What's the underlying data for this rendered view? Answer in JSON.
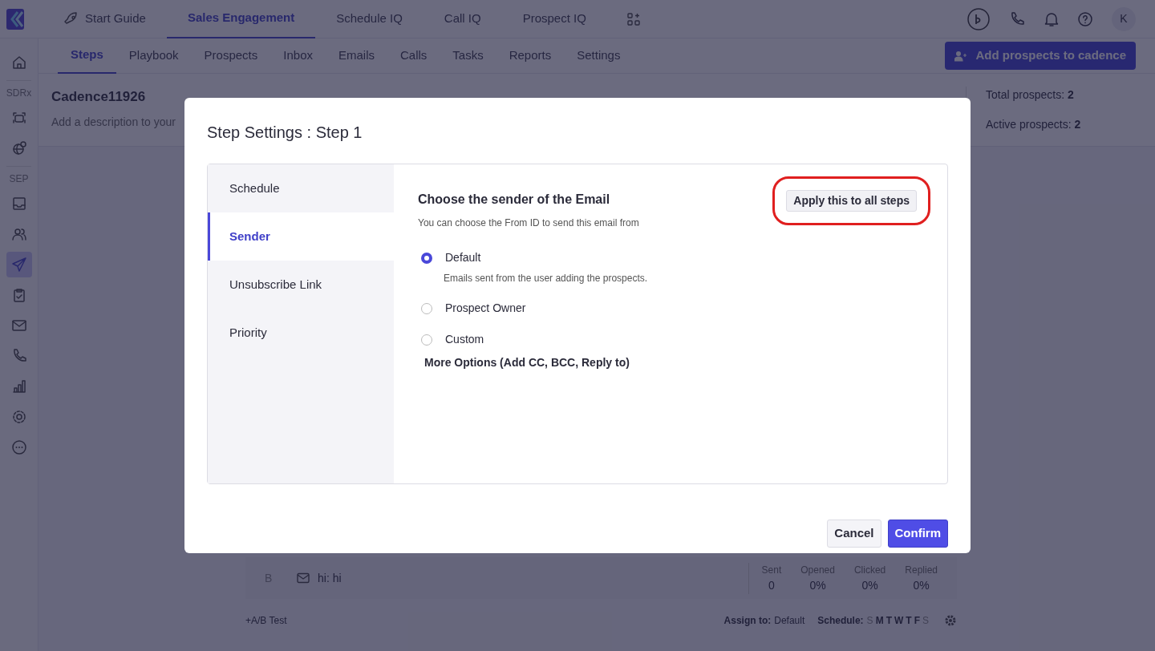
{
  "top_nav": {
    "tabs": [
      {
        "label": "Start Guide",
        "selected": false
      },
      {
        "label": "Sales Engagement",
        "selected": true
      },
      {
        "label": "Schedule IQ",
        "selected": false
      },
      {
        "label": "Call IQ",
        "selected": false
      },
      {
        "label": "Prospect IQ",
        "selected": false
      }
    ],
    "avatar": "K"
  },
  "sidebar": {
    "groups": [
      {
        "items": [
          {
            "selected": false
          }
        ]
      },
      {
        "label": "SDRx",
        "items": [
          {
            "selected": false
          },
          {
            "selected": false
          }
        ]
      },
      {
        "label": "SEP",
        "items": [
          {
            "selected": false
          },
          {
            "selected": false
          },
          {
            "selected": true
          },
          {
            "selected": false
          },
          {
            "selected": false
          },
          {
            "selected": false
          },
          {
            "selected": false
          },
          {
            "selected": false
          },
          {
            "selected": false
          }
        ]
      }
    ]
  },
  "sub_nav": {
    "tabs": [
      {
        "label": "Steps",
        "selected": true
      },
      {
        "label": "Playbook",
        "selected": false
      },
      {
        "label": "Prospects",
        "selected": false
      },
      {
        "label": "Inbox",
        "selected": false
      },
      {
        "label": "Emails",
        "selected": false
      },
      {
        "label": "Calls",
        "selected": false
      },
      {
        "label": "Tasks",
        "selected": false
      },
      {
        "label": "Reports",
        "selected": false
      },
      {
        "label": "Settings",
        "selected": false
      }
    ],
    "action": "Add prospects to cadence"
  },
  "cadence": {
    "name": "Cadence11926",
    "description": {
      "placeholder": "Add a description to your"
    },
    "total_prospects": "Total prospects: **2**",
    "active_prospects": "Active prospects: **2**"
  },
  "step_variant": {
    "label": "B",
    "subject": "hi: hi",
    "stats": [
      {
        "label": "Sent",
        "value": "0"
      },
      {
        "label": "Opened",
        "value": "0%"
      },
      {
        "label": "Clicked",
        "value": "0%"
      },
      {
        "label": "Replied",
        "value": "0%"
      }
    ]
  },
  "step_footer": {
    "ab_test": "+A/B Test",
    "assign_label": "Assign to:",
    "assign_value": "Default",
    "schedule_label": "Schedule:",
    "days": [
      {
        "label": "S",
        "on": false
      },
      {
        "label": "M",
        "on": true
      },
      {
        "label": "T",
        "on": true
      },
      {
        "label": "W",
        "on": true
      },
      {
        "label": "T",
        "on": true
      },
      {
        "label": "F",
        "on": true
      },
      {
        "label": "S",
        "on": false
      }
    ]
  },
  "modal": {
    "title": "Step Settings : Step 1",
    "tabs": [
      {
        "label": "Schedule",
        "selected": false
      },
      {
        "label": "Sender",
        "selected": true
      },
      {
        "label": "Unsubscribe Link",
        "selected": false
      },
      {
        "label": "Priority",
        "selected": false
      }
    ],
    "heading": "Choose the sender of the Email",
    "subheading": "You can choose the From ID to send this email from",
    "apply_button": "Apply this to all steps",
    "apply_highlighted": true,
    "options": [
      {
        "label": "Default",
        "description": "Emails sent from the user adding the prospects.",
        "selected": true
      },
      {
        "label": "Prospect Owner",
        "selected": false
      },
      {
        "label": "Custom",
        "selected": false
      }
    ],
    "more_options": "More Options (Add CC, BCC, Reply to)",
    "buttons": [
      {
        "label": "Cancel",
        "kind": "secondary"
      },
      {
        "label": "Confirm",
        "kind": "primary"
      }
    ]
  }
}
